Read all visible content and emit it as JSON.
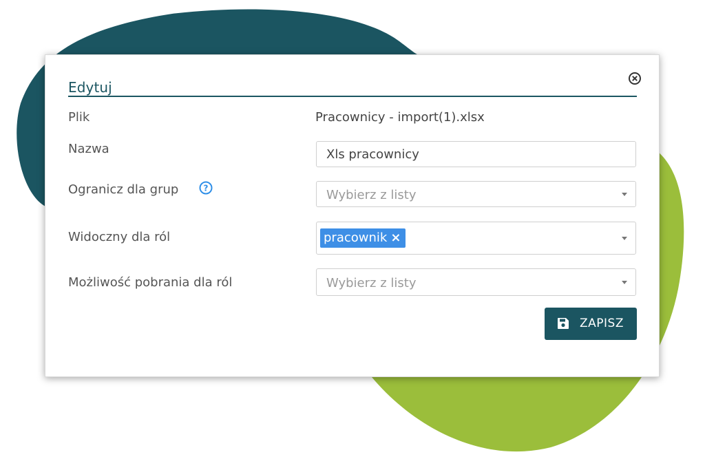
{
  "dialog": {
    "title": "Edytuj",
    "close_icon": "close-circle-icon"
  },
  "form": {
    "file": {
      "label": "Plik",
      "value": "Pracownicy - import(1).xlsx"
    },
    "name": {
      "label": "Nazwa",
      "value": "Xls pracownicy"
    },
    "groups": {
      "label": "Ogranicz dla grup",
      "help_icon": "question-circle-icon",
      "placeholder": "Wybierz z listy"
    },
    "visible_roles": {
      "label": "Widoczny dla ról",
      "selected_tag": "pracownik",
      "remove_glyph": "×"
    },
    "download_roles": {
      "label": "Możliwość pobrania dla ról",
      "placeholder": "Wybierz z listy"
    }
  },
  "actions": {
    "save_label": "ZAPISZ",
    "save_icon": "floppy-disk-icon"
  },
  "colors": {
    "accent": "#1b5561",
    "tag_blue": "#3e8fe6",
    "help_blue": "#2f8fe8",
    "blob_green": "#9bbe3b",
    "blob_teal": "#1b5561"
  }
}
